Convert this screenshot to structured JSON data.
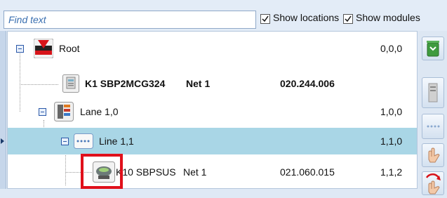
{
  "toolbar": {
    "search_placeholder": "Find text",
    "show_locations_label": "Show locations",
    "show_locations_checked": true,
    "show_modules_label": "Show modules",
    "show_modules_checked": true
  },
  "tree": {
    "rows": [
      {
        "name": "Root",
        "address": "0,0,0"
      },
      {
        "name": "K1 SBP2MCG324",
        "net": "Net 1",
        "serial": "020.244.006"
      },
      {
        "name": "Lane 1,0",
        "address": "1,0,0"
      },
      {
        "name": "Line 1,1",
        "address": "1,1,0",
        "selected": true
      },
      {
        "name": "K10 SBPSUS",
        "net": "Net 1",
        "serial": "021.060.015",
        "address": "1,1,2"
      }
    ]
  },
  "colors": {
    "selection": "#a9d6e6",
    "highlight_box": "#e0101b",
    "accent": "#2b58a8"
  },
  "icons": {
    "root": "carlo-gavazzi-logo-icon",
    "module": "device-module-icon",
    "lane": "lane-icon",
    "line": "line-icon",
    "sensor": "sensor-icon"
  }
}
